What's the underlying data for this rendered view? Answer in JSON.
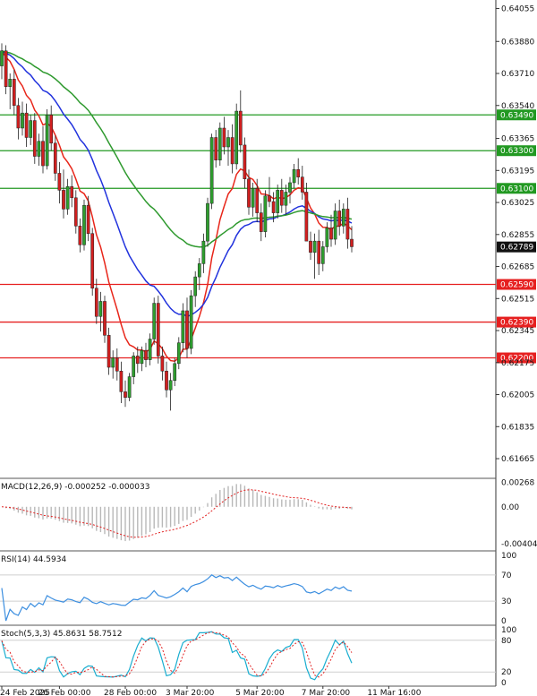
{
  "chart_data": {
    "type": "candlestick",
    "instrument": "",
    "colors": {
      "up": "#2e9e2e",
      "down": "#d11f1f",
      "ma_fast": "#e8261a",
      "ma_slow": "#2233dd",
      "ma_long": "#2f9a2f",
      "resistance": "#229922",
      "support": "#e62020",
      "current_price": "#111111",
      "macd_hist": "#b8b8b8",
      "macd_signal": "#e22222",
      "rsi": "#3d8fe0",
      "stoch_main": "#1aaed0",
      "stoch_signal": "#e22222"
    },
    "price_axis": {
      "range": [
        0.6157,
        0.641
      ],
      "ticks": [
        "0.64055",
        "0.63880",
        "0.63710",
        "0.63540",
        "0.63365",
        "0.63195",
        "0.63025",
        "0.62855",
        "0.62685",
        "0.62515",
        "0.62345",
        "0.62175",
        "0.62005",
        "0.61835",
        "0.61665"
      ]
    },
    "time_axis": {
      "labels": [
        "24 Feb 2025",
        "26 Feb 00:00",
        "28 Feb 00:00",
        "3 Mar 20:00",
        "5 Mar 20:00",
        "7 Mar 20:00",
        "11 Mar 16:00"
      ],
      "label_index": [
        0,
        14,
        30,
        45,
        62,
        78,
        94
      ]
    },
    "current_price": "0.62789",
    "current_price_value": 0.62789,
    "resistance_levels": [
      {
        "label": "0.63490",
        "value": 0.6349
      },
      {
        "label": "0.63300",
        "value": 0.633
      },
      {
        "label": "0.63100",
        "value": 0.631
      }
    ],
    "support_levels": [
      {
        "label": "0.62590",
        "value": 0.6259
      },
      {
        "label": "0.62390",
        "value": 0.6239
      },
      {
        "label": "0.62200",
        "value": 0.622
      }
    ],
    "ohlc": [
      [
        0.6375,
        0.6387,
        0.6368,
        0.6383
      ],
      [
        0.6383,
        0.6386,
        0.636,
        0.6364
      ],
      [
        0.6364,
        0.6371,
        0.6352,
        0.6368
      ],
      [
        0.6368,
        0.6373,
        0.6349,
        0.6354
      ],
      [
        0.6354,
        0.6358,
        0.6336,
        0.6342
      ],
      [
        0.6342,
        0.6356,
        0.6338,
        0.635
      ],
      [
        0.635,
        0.6355,
        0.6332,
        0.6337
      ],
      [
        0.6337,
        0.6349,
        0.6333,
        0.6346
      ],
      [
        0.6346,
        0.635,
        0.6323,
        0.6327
      ],
      [
        0.6327,
        0.6339,
        0.6322,
        0.6335
      ],
      [
        0.6335,
        0.6343,
        0.6318,
        0.6322
      ],
      [
        0.6322,
        0.6352,
        0.632,
        0.6349
      ],
      [
        0.6349,
        0.6354,
        0.633,
        0.6334
      ],
      [
        0.6334,
        0.6338,
        0.6314,
        0.6318
      ],
      [
        0.6318,
        0.6324,
        0.6302,
        0.6309
      ],
      [
        0.6309,
        0.632,
        0.6294,
        0.6299
      ],
      [
        0.6299,
        0.6315,
        0.6296,
        0.6311
      ],
      [
        0.6311,
        0.6317,
        0.63,
        0.6305
      ],
      [
        0.6305,
        0.6309,
        0.6286,
        0.629
      ],
      [
        0.629,
        0.6294,
        0.6276,
        0.628
      ],
      [
        0.628,
        0.6304,
        0.6277,
        0.6301
      ],
      [
        0.6301,
        0.6306,
        0.6282,
        0.6286
      ],
      [
        0.6286,
        0.6289,
        0.6253,
        0.6257
      ],
      [
        0.6257,
        0.6262,
        0.6238,
        0.6242
      ],
      [
        0.6242,
        0.6255,
        0.6234,
        0.625
      ],
      [
        0.625,
        0.6253,
        0.6228,
        0.6232
      ],
      [
        0.6232,
        0.6236,
        0.6211,
        0.6215
      ],
      [
        0.6215,
        0.6224,
        0.6209,
        0.622
      ],
      [
        0.622,
        0.6225,
        0.6208,
        0.6213
      ],
      [
        0.6213,
        0.6218,
        0.6196,
        0.6202
      ],
      [
        0.6202,
        0.6208,
        0.6194,
        0.6199
      ],
      [
        0.6199,
        0.6212,
        0.6197,
        0.621
      ],
      [
        0.621,
        0.6223,
        0.6206,
        0.6221
      ],
      [
        0.6221,
        0.6226,
        0.6212,
        0.6217
      ],
      [
        0.6217,
        0.6226,
        0.6213,
        0.6224
      ],
      [
        0.6224,
        0.6228,
        0.6215,
        0.6219
      ],
      [
        0.6219,
        0.6233,
        0.6216,
        0.623
      ],
      [
        0.623,
        0.6252,
        0.6227,
        0.6249
      ],
      [
        0.6249,
        0.6253,
        0.6217,
        0.6221
      ],
      [
        0.6221,
        0.6226,
        0.6208,
        0.6213
      ],
      [
        0.6213,
        0.6218,
        0.6199,
        0.6203
      ],
      [
        0.6203,
        0.6212,
        0.6192,
        0.6208
      ],
      [
        0.6208,
        0.622,
        0.6205,
        0.6217
      ],
      [
        0.6217,
        0.6231,
        0.6214,
        0.6228
      ],
      [
        0.6228,
        0.6249,
        0.6223,
        0.6245
      ],
      [
        0.6245,
        0.6252,
        0.622,
        0.6225
      ],
      [
        0.6225,
        0.6256,
        0.6222,
        0.6253
      ],
      [
        0.6253,
        0.6266,
        0.6247,
        0.6263
      ],
      [
        0.6263,
        0.6273,
        0.6256,
        0.627
      ],
      [
        0.627,
        0.6286,
        0.6265,
        0.6282
      ],
      [
        0.6282,
        0.6305,
        0.6279,
        0.6302
      ],
      [
        0.6302,
        0.6339,
        0.6299,
        0.6337
      ],
      [
        0.6337,
        0.6341,
        0.6321,
        0.6325
      ],
      [
        0.6325,
        0.6345,
        0.6322,
        0.6342
      ],
      [
        0.6342,
        0.6348,
        0.6328,
        0.6332
      ],
      [
        0.6332,
        0.6341,
        0.6322,
        0.6337
      ],
      [
        0.6337,
        0.6344,
        0.6318,
        0.6323
      ],
      [
        0.6323,
        0.6355,
        0.632,
        0.6351
      ],
      [
        0.6351,
        0.6362,
        0.6329,
        0.6333
      ],
      [
        0.6333,
        0.6337,
        0.631,
        0.6315
      ],
      [
        0.6315,
        0.632,
        0.6296,
        0.63
      ],
      [
        0.63,
        0.6313,
        0.6295,
        0.631
      ],
      [
        0.631,
        0.6315,
        0.6292,
        0.6297
      ],
      [
        0.6297,
        0.6302,
        0.6282,
        0.6287
      ],
      [
        0.6287,
        0.6309,
        0.6284,
        0.6306
      ],
      [
        0.6306,
        0.6316,
        0.63,
        0.6303
      ],
      [
        0.6303,
        0.6308,
        0.6292,
        0.6297
      ],
      [
        0.6297,
        0.6312,
        0.6294,
        0.6309
      ],
      [
        0.6309,
        0.6315,
        0.6297,
        0.6301
      ],
      [
        0.6301,
        0.6312,
        0.6296,
        0.6308
      ],
      [
        0.6308,
        0.6316,
        0.6302,
        0.6313
      ],
      [
        0.6313,
        0.6323,
        0.631,
        0.632
      ],
      [
        0.632,
        0.6326,
        0.6312,
        0.6316
      ],
      [
        0.6316,
        0.6322,
        0.6304,
        0.6308
      ],
      [
        0.6308,
        0.6313,
        0.629,
        0.6282
      ],
      [
        0.6282,
        0.6287,
        0.6272,
        0.6276
      ],
      [
        0.6276,
        0.6286,
        0.6262,
        0.6282
      ],
      [
        0.6282,
        0.6288,
        0.6264,
        0.627
      ],
      [
        0.627,
        0.6282,
        0.6266,
        0.6279
      ],
      [
        0.6279,
        0.6292,
        0.6276,
        0.6289
      ],
      [
        0.6289,
        0.6296,
        0.6279,
        0.6283
      ],
      [
        0.6283,
        0.6302,
        0.628,
        0.6298
      ],
      [
        0.6298,
        0.6304,
        0.6285,
        0.629
      ],
      [
        0.629,
        0.6302,
        0.6286,
        0.6299
      ],
      [
        0.6299,
        0.6305,
        0.6278,
        0.6283
      ],
      [
        0.6283,
        0.629,
        0.6276,
        0.6279
      ]
    ],
    "macd": {
      "label": "MACD(12,26,9) -0.000252 -0.000033",
      "axis_ticks": [
        "0.00268",
        "0.00",
        "-0.004041"
      ],
      "range": [
        -0.0047,
        0.003
      ]
    },
    "rsi": {
      "label": "RSI(14) 44.5934",
      "axis_ticks": [
        "100",
        "70",
        "30",
        "0"
      ],
      "range": [
        0,
        100
      ]
    },
    "stoch": {
      "label": "Stoch(5,3,3) 45.8631 58.7512",
      "axis_ticks": [
        "100",
        "80",
        "20",
        "0"
      ],
      "range": [
        0,
        100
      ]
    }
  }
}
